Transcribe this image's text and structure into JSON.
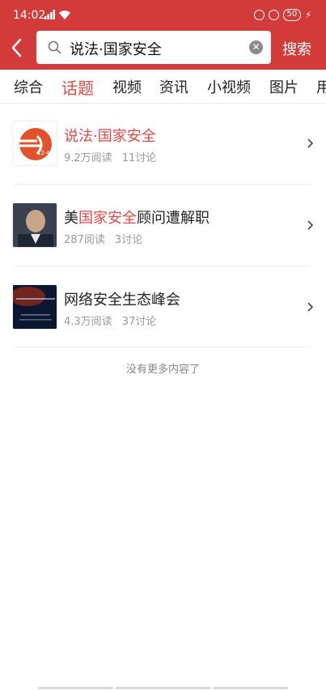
{
  "status_bar": {
    "time": "14:02",
    "signal": "5ᴳ",
    "battery": "50"
  },
  "header": {
    "search_value": "说法·国家安全",
    "search_button": "搜索",
    "accent_color": "#d33b3b"
  },
  "tabs": [
    {
      "label": "综合"
    },
    {
      "label": "话题"
    },
    {
      "label": "视频"
    },
    {
      "label": "资讯"
    },
    {
      "label": "小视频"
    },
    {
      "label": "图片"
    },
    {
      "label": "用"
    }
  ],
  "active_tab": "话题",
  "results": [
    {
      "title_pre": "",
      "title_hl": "说法·国家安全",
      "title_post": "",
      "reads": "9.2万阅读",
      "discussions": "11讨论",
      "thumb_text": "12·4"
    },
    {
      "title_pre": "美",
      "title_hl": "国家安全",
      "title_post": "顾问遭解职",
      "reads": "287阅读",
      "discussions": "3讨论"
    },
    {
      "title_pre": "网络安全生态峰会",
      "title_hl": "",
      "title_post": "",
      "reads": "4.3万阅读",
      "discussions": "37讨论"
    }
  ],
  "end_message": "没有更多内容了"
}
